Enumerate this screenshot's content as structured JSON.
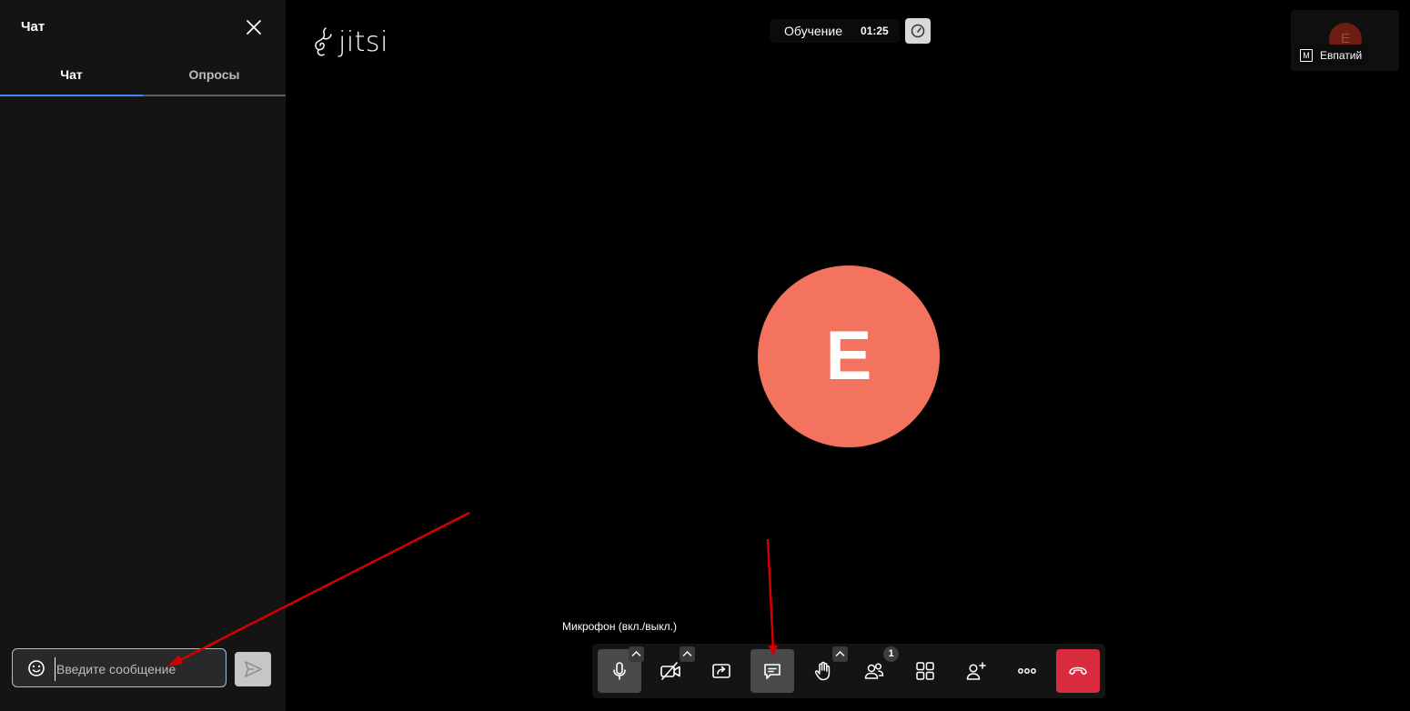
{
  "chat": {
    "title": "Чат",
    "tabs": [
      {
        "label": "Чат",
        "active": true
      },
      {
        "label": "Опросы",
        "active": false
      }
    ],
    "input_placeholder": "Введите сообщение",
    "input_value": ""
  },
  "header": {
    "logo_text": "jitsi",
    "subject": "Обучение",
    "timer": "01:25"
  },
  "self_view": {
    "initial": "E",
    "name": "Евпатий",
    "moderator_mark": "M"
  },
  "main": {
    "avatar_initial": "E",
    "avatar_color": "#f4735e"
  },
  "toolbar": {
    "tooltip": "Микрофон (вкл./выкл.)",
    "participants_count": "1",
    "buttons": [
      "microphone",
      "camera",
      "share-screen",
      "chat",
      "raise-hand",
      "participants",
      "tile-view",
      "invite",
      "more",
      "hangup"
    ],
    "hangup_color": "#d82c3e"
  },
  "annotations": {
    "arrow_color": "#d40000"
  }
}
